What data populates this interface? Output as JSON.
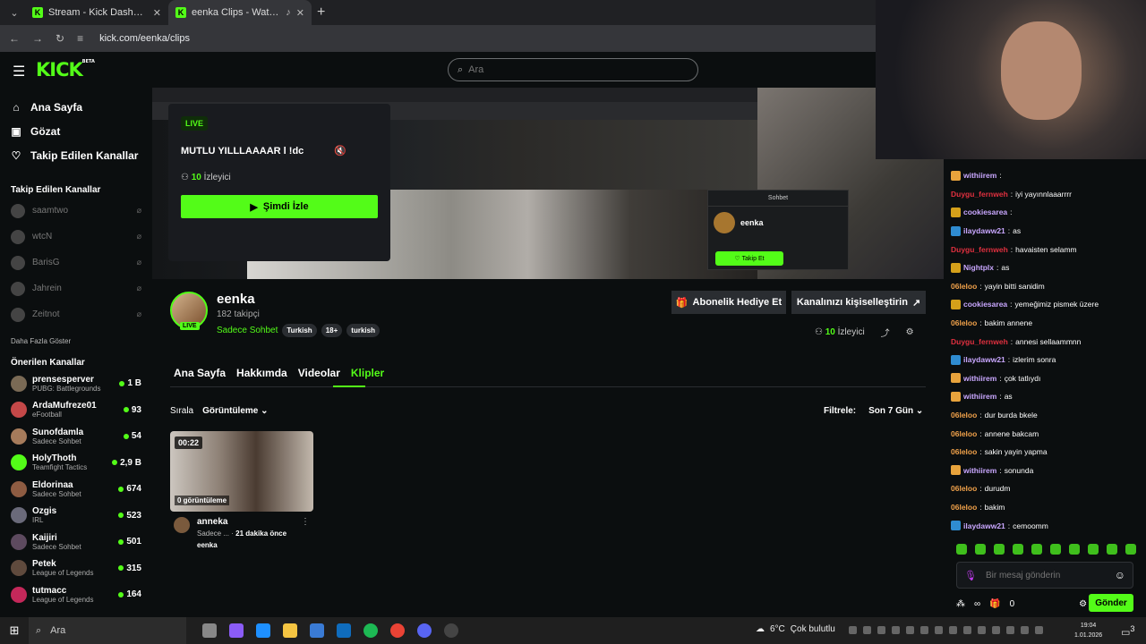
{
  "browser": {
    "tabs": [
      {
        "title": "Stream - Kick Dashboard"
      },
      {
        "title": "eenka Clips - Watch Live o"
      }
    ],
    "url": "kick.com/eenka/clips"
  },
  "header": {
    "logo": "KICK",
    "logo_sup": "BETA",
    "search_placeholder": "Ara"
  },
  "sidebar": {
    "nav": [
      {
        "label": "Ana Sayfa",
        "icon": "home-icon"
      },
      {
        "label": "Gözat",
        "icon": "browse-icon"
      },
      {
        "label": "Takip Edilen Kanallar",
        "icon": "heart-icon"
      }
    ],
    "followed_title": "Takip Edilen Kanallar",
    "followed": [
      "saamtwo",
      "wtcN",
      "BarisG",
      "Jahrein",
      "Zeitnot"
    ],
    "more_label": "Daha Fazla Göster",
    "recommended_title": "Önerilen Kanallar",
    "recommended": [
      {
        "name": "prensesperver",
        "category": "PUBG: Battlegrounds",
        "viewers": "1 B",
        "color": "#7a6a55"
      },
      {
        "name": "ArdaMufreze01",
        "category": "eFootball",
        "viewers": "93",
        "color": "#c44848"
      },
      {
        "name": "Sunofdamla",
        "category": "Sadece Sohbet",
        "viewers": "54",
        "color": "#a67b5b"
      },
      {
        "name": "HolyThoth",
        "category": "Teamfight Tactics",
        "viewers": "2,9 B",
        "color": "#53fc18"
      },
      {
        "name": "Eldorinaa",
        "category": "Sadece Sohbet",
        "viewers": "674",
        "color": "#8e5c42"
      },
      {
        "name": "Ozgis",
        "category": "IRL",
        "viewers": "523",
        "color": "#6a6a7a"
      },
      {
        "name": "Kaijiri",
        "category": "Sadece Sohbet",
        "viewers": "501",
        "color": "#5d4a5f"
      },
      {
        "name": "Petek",
        "category": "League of Legends",
        "viewers": "315",
        "color": "#5f4a3d"
      },
      {
        "name": "tutmacc",
        "category": "League of Legends",
        "viewers": "164",
        "color": "#c4285a"
      }
    ]
  },
  "popover": {
    "live": "LIVE",
    "title": "MUTLU YILLLAAAAR l !dc",
    "viewers_count": "10",
    "viewers_label": "İzleyici",
    "watch_label": "Şimdi İzle"
  },
  "preview": {
    "chat_header": "Sohbet",
    "chat_name": "eenka",
    "follow_label": "Takip Et"
  },
  "channel": {
    "name": "eenka",
    "followers": "182 takipçi",
    "category": "Sadece Sohbet",
    "tags": [
      "Turkish",
      "18+",
      "turkish"
    ],
    "live": "LIVE",
    "gift_label": "Abonelik Hediye Et",
    "customize_label": "Kanalınızı kişiselleştirin",
    "viewers_count": "10",
    "viewers_label": "İzleyici",
    "tabs": [
      "Ana Sayfa",
      "Hakkımda",
      "Videolar",
      "Klipler"
    ],
    "active_tab": "Klipler",
    "sort_label": "Sırala",
    "sort_value": "Görüntüleme",
    "filter_label": "Filtrele:",
    "filter_value": "Son 7 Gün"
  },
  "clips": [
    {
      "duration": "00:22",
      "views": "0 görüntüleme",
      "title": "anneka",
      "category": "Sadece ...",
      "time": "21 dakika önce",
      "author": "eenka"
    }
  ],
  "chat": {
    "messages": [
      {
        "user": "withiirem",
        "text": "",
        "color": "#c9a7ff",
        "badge": "#e8a33c"
      },
      {
        "user": "Duygu_fernweh",
        "text": "iyi yayınnlaaarrrr",
        "color": "#e0303f",
        "badge": ""
      },
      {
        "user": "cookiesarea",
        "text": "",
        "color": "#c9a7ff",
        "badge": "#d4a01a"
      },
      {
        "user": "ilaydaww21",
        "text": "as",
        "color": "#c9a7ff",
        "badge": "#2f8cd1"
      },
      {
        "user": "Duygu_fernweh",
        "text": "havaisten selamm",
        "color": "#e0303f",
        "badge": ""
      },
      {
        "user": "Nightplx",
        "text": "as",
        "color": "#c9a7ff",
        "badge": "#d4a01a"
      },
      {
        "user": "06leloo",
        "text": "yayin bitti sanidim",
        "color": "#f0a14a",
        "badge": ""
      },
      {
        "user": "cookiesarea",
        "text": "yemeğimiz pismek üzere",
        "color": "#c9a7ff",
        "badge": "#d4a01a"
      },
      {
        "user": "06leloo",
        "text": "bakim annene",
        "color": "#f0a14a",
        "badge": ""
      },
      {
        "user": "Duygu_fernweh",
        "text": "annesi sellaammnn",
        "color": "#e0303f",
        "badge": ""
      },
      {
        "user": "ilaydaww21",
        "text": "izlerim sonra",
        "color": "#c9a7ff",
        "badge": "#2f8cd1"
      },
      {
        "user": "withiirem",
        "text": "çok tatlıydı",
        "color": "#c9a7ff",
        "badge": "#e8a33c"
      },
      {
        "user": "withiirem",
        "text": "as",
        "color": "#c9a7ff",
        "badge": "#e8a33c"
      },
      {
        "user": "06leloo",
        "text": "dur burda bkele",
        "color": "#f0a14a",
        "badge": ""
      },
      {
        "user": "06leloo",
        "text": "annene bakcam",
        "color": "#f0a14a",
        "badge": ""
      },
      {
        "user": "06leloo",
        "text": "sakin yayin yapma",
        "color": "#f0a14a",
        "badge": ""
      },
      {
        "user": "withiirem",
        "text": "sonunda",
        "color": "#c9a7ff",
        "badge": "#e8a33c"
      },
      {
        "user": "06leloo",
        "text": "durudm",
        "color": "#f0a14a",
        "badge": ""
      },
      {
        "user": "06leloo",
        "text": "bakim",
        "color": "#f0a14a",
        "badge": ""
      },
      {
        "user": "ilaydaww21",
        "text": "cemoomm",
        "color": "#c9a7ff",
        "badge": "#2f8cd1"
      }
    ],
    "input_placeholder": "Bir mesaj gönderin",
    "infinity": "∞",
    "points": "0",
    "send_label": "Gönder"
  },
  "taskbar": {
    "search_label": "Ara",
    "weather": "6°C",
    "weather_text": "Çok bulutlu",
    "time": "19:04",
    "date": "1.01.2026",
    "notif_count": "3"
  }
}
